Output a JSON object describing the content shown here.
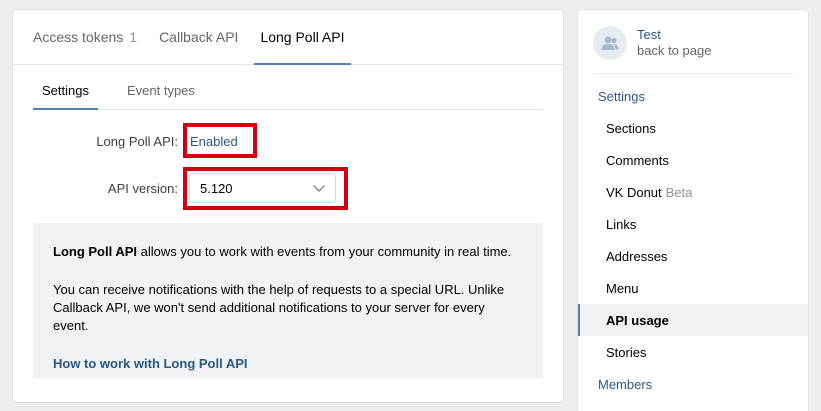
{
  "tabs": [
    {
      "label": "Access tokens",
      "count": "1"
    },
    {
      "label": "Callback API"
    },
    {
      "label": "Long Poll API",
      "active": true
    }
  ],
  "subtabs": [
    {
      "label": "Settings",
      "active": true
    },
    {
      "label": "Event types"
    }
  ],
  "form": {
    "longpoll_label": "Long Poll API:",
    "longpoll_value": "Enabled",
    "version_label": "API version:",
    "version_value": "5.120"
  },
  "info": {
    "p1_bold": "Long Poll API",
    "p1_rest": " allows you to work with events from your community in real time.",
    "p2": "You can receive notifications with the help of requests to a special URL. Unlike Callback API, we won't send additional notifications to your server for every event.",
    "link": "How to work with Long Poll API"
  },
  "side": {
    "group_name": "Test",
    "back": "back to page",
    "menu": [
      {
        "label": "Settings",
        "level": "top"
      },
      {
        "label": "Sections",
        "level": "sub"
      },
      {
        "label": "Comments",
        "level": "sub"
      },
      {
        "label": "VK Donut",
        "badge": "Beta",
        "level": "sub"
      },
      {
        "label": "Links",
        "level": "sub"
      },
      {
        "label": "Addresses",
        "level": "sub"
      },
      {
        "label": "Menu",
        "level": "sub"
      },
      {
        "label": "API usage",
        "level": "sub",
        "active": true
      },
      {
        "label": "Stories",
        "level": "sub"
      },
      {
        "label": "Members",
        "level": "top"
      }
    ]
  },
  "colors": {
    "accent": "#5181b8",
    "link": "#2a5885",
    "highlight_box": "#d2000f"
  }
}
